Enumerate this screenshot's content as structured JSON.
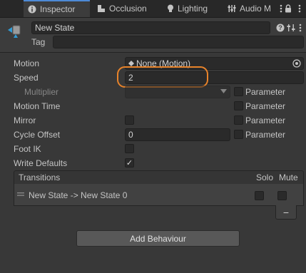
{
  "tabs": [
    {
      "label": "Inspector",
      "icon": "info-icon",
      "active": true
    },
    {
      "label": "Occlusion",
      "icon": "occlusion-icon",
      "active": false
    },
    {
      "label": "Lighting",
      "icon": "lightbulb-icon",
      "active": false
    },
    {
      "label": "Audio M",
      "icon": "audio-mixer-icon",
      "active": false
    }
  ],
  "header": {
    "name_value": "New State",
    "tag_label": "Tag",
    "tag_value": ""
  },
  "properties": {
    "motion_label": "Motion",
    "motion_value": "None (Motion)",
    "speed_label": "Speed",
    "speed_value": "2",
    "multiplier_label": "Multiplier",
    "motion_time_label": "Motion Time",
    "mirror_label": "Mirror",
    "cycle_offset_label": "Cycle Offset",
    "cycle_offset_value": "0",
    "foot_ik_label": "Foot IK",
    "write_defaults_label": "Write Defaults",
    "parameter_label": "Parameter"
  },
  "transitions": {
    "header": "Transitions",
    "solo_label": "Solo",
    "mute_label": "Mute",
    "rows": [
      {
        "label": "New State -> New State 0"
      }
    ],
    "remove_label": "−"
  },
  "add_behaviour_label": "Add Behaviour",
  "colors": {
    "highlight_circle": "#e8832a",
    "active_tab_accent": "#4d8ad6"
  }
}
